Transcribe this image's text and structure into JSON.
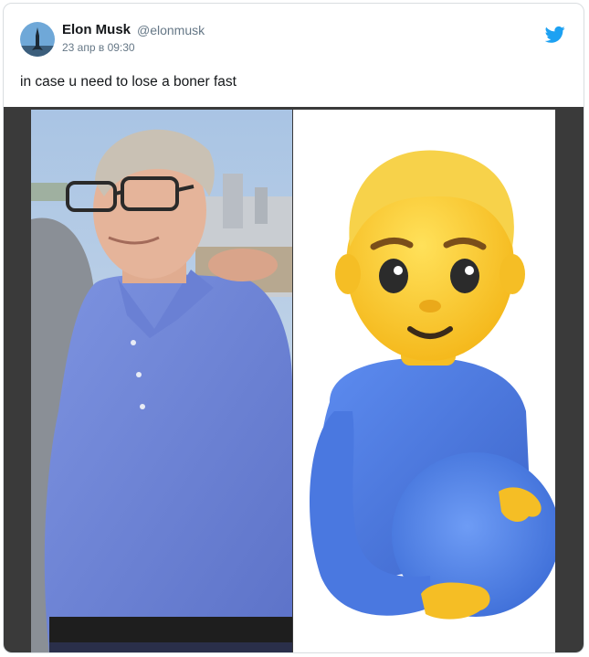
{
  "tweet": {
    "author_name": "Elon Musk",
    "author_handle": "@elonmusk",
    "timestamp": "23 апр в 09:30",
    "text": "in case u need to lose a boner fast"
  },
  "icons": {
    "brand": "twitter-bird-icon",
    "avatar": "rocket-avatar"
  },
  "colors": {
    "twitter_blue": "#1da1f2",
    "text_primary": "#14171a",
    "text_secondary": "#657786",
    "media_background": "#3a3a3a"
  }
}
